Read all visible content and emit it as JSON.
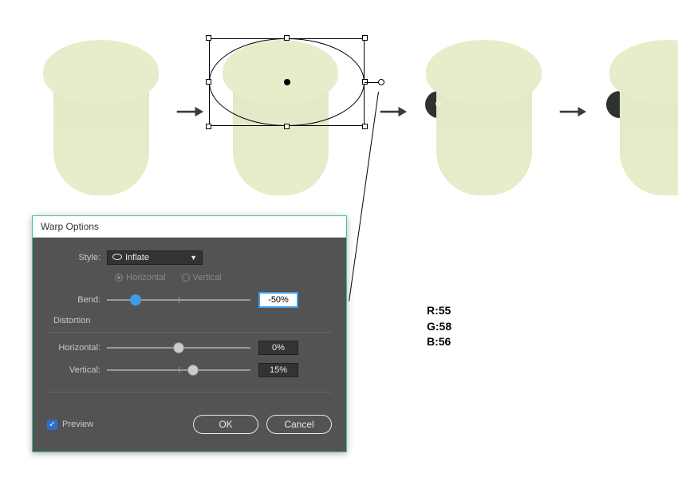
{
  "dialog": {
    "title": "Warp Options",
    "style_label": "Style:",
    "style_value": "Inflate",
    "orientation": {
      "horizontal": "Horizontal",
      "vertical": "Vertical",
      "selected": "horizontal"
    },
    "bend_label": "Bend:",
    "bend_value": "-50%",
    "bend_pos_pct": 20,
    "distortion_label": "Distortion",
    "horizontal_label": "Horizontal:",
    "horizontal_value": "0%",
    "horizontal_pos_pct": 50,
    "vertical_label": "Vertical:",
    "vertical_value": "15%",
    "vertical_pos_pct": 60,
    "preview_label": "Preview",
    "preview_checked": true,
    "ok_label": "OK",
    "cancel_label": "Cancel"
  },
  "rgb": {
    "r_label": "R:55",
    "g_label": "G:58",
    "b_label": "B:56"
  },
  "colors": {
    "shape_fill": "#e8ecca",
    "ear_fill": "#2d3130"
  }
}
